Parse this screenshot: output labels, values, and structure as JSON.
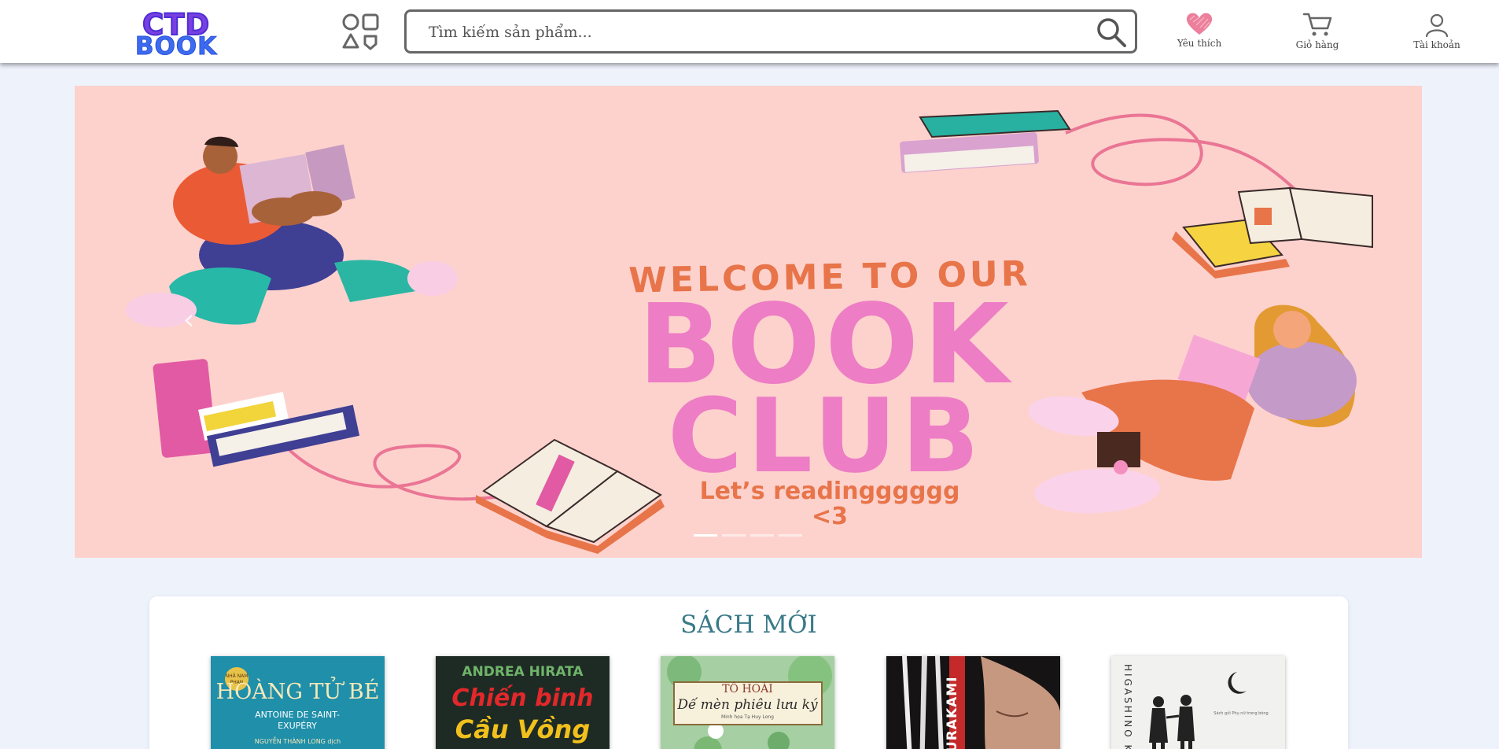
{
  "header": {
    "logo_line1": "CTD",
    "logo_line2": "BOOK",
    "search_placeholder": "Tìm kiếm sản phẩm...",
    "favorites_label": "Yêu thích",
    "cart_label": "Giỏ hàng",
    "account_label": "Tài khoản"
  },
  "banner": {
    "welcome": "WELCOME TO OUR",
    "line1": "BOOK",
    "line2": "CLUB",
    "tagline_1": "Let’s readingggggg",
    "tagline_2": "<3",
    "prev_icon": "‹",
    "next_icon": "›",
    "slide_count": 4,
    "active_slide": 1
  },
  "new_books": {
    "title": "SÁCH MỚI",
    "books": [
      {
        "publisher": "NHÃ NAM PHAN",
        "title": "HOÀNG TỬ BÉ",
        "author": "ANTOINE DE SAINT-EXUPÉRY",
        "translator": "NGUYỄN THÀNH LONG dịch"
      },
      {
        "author": "ANDREA HIRATA",
        "title_1": "Chiến binh",
        "title_2": "Cầu Vồng"
      },
      {
        "author": "TÔ HOÀI",
        "title": "Dế mèn phiêu lưu ký",
        "illustrator": "Minh họa Tạ Huy Long"
      },
      {
        "author": "MURAKAMI"
      },
      {
        "author": "HIGASHINO K",
        "note": "Sách gửi Phụ nữ trong bóng"
      }
    ]
  }
}
